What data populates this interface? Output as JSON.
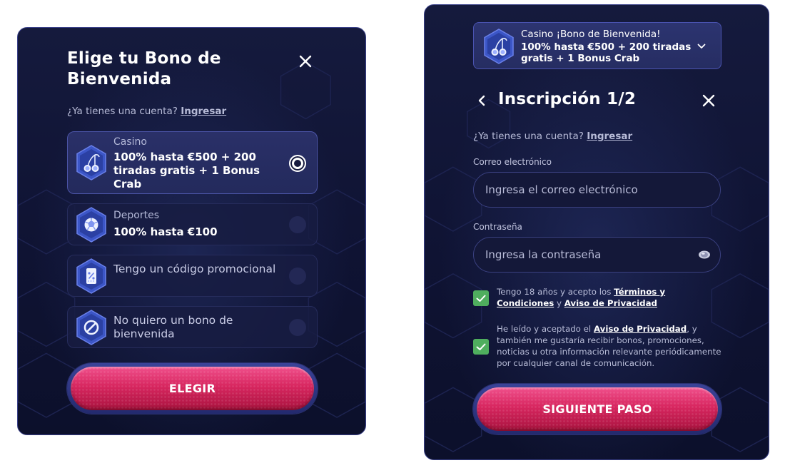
{
  "bonus_modal": {
    "title": "Elige tu Bono de Bienvenida",
    "account_prompt": "¿Ya tienes una cuenta?",
    "login_link": "Ingresar",
    "options": [
      {
        "category": "Casino",
        "label": "100% hasta €500 + 200 tiradas gratis + 1 Bonus Crab",
        "icon": "cherries-icon",
        "selected": true
      },
      {
        "category": "Deportes",
        "label": "100% hasta €100",
        "icon": "soccer-ball-icon",
        "selected": false
      },
      {
        "category": "",
        "label": "Tengo un código promocional",
        "icon": "promo-ticket-icon",
        "selected": false
      },
      {
        "category": "",
        "label": "No quiero un bono de bienvenida",
        "icon": "no-bonus-icon",
        "selected": false
      }
    ],
    "choose_button": "ELEGIR"
  },
  "signup_modal": {
    "bonus_banner": {
      "line1": "Casino ¡Bono de Bienvenida!",
      "line2": "100% hasta €500 + 200 tiradas gratis + 1 Bonus Crab",
      "icon": "cherries-icon"
    },
    "title": "Inscripción 1/2",
    "account_prompt": "¿Ya tienes una cuenta?",
    "login_link": "Ingresar",
    "email": {
      "label": "Correo electrónico",
      "placeholder": "Ingresa el correo electrónico",
      "value": ""
    },
    "password": {
      "label": "Contraseña",
      "placeholder": "Ingresa la contraseña",
      "value": ""
    },
    "terms": {
      "checked": true,
      "text_before": "Tengo 18 años y acepto los ",
      "link1": "Términos y Condiciones",
      "text_mid": " y ",
      "link2": "Aviso de Privacidad"
    },
    "marketing": {
      "checked": true,
      "text_before": "He leído y aceptado el ",
      "link": "Aviso de Privacidad",
      "text_after": ", y también me gustaría recibir bonos, promociones, noticias u otra información relevante periódicamente por cualquier canal de comunicación."
    },
    "next_button": "SIGUIENTE PASO"
  },
  "colors": {
    "modal_bg": "#0f1333",
    "border": "#39408a",
    "cta_pink": "#d7265f",
    "check_green": "#4fae5e",
    "text_muted": "#b6bad6"
  }
}
